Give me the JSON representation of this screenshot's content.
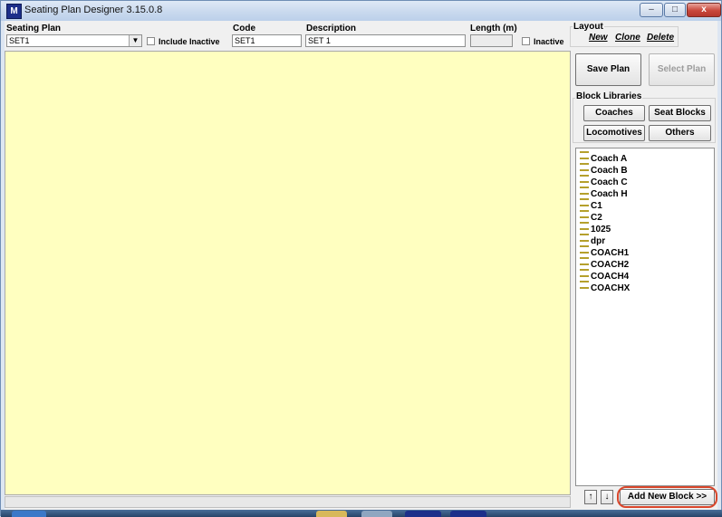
{
  "window": {
    "icon_text": "M",
    "title": "Seating Plan Designer  3.15.0.8",
    "min_glyph": "–",
    "max_glyph": "□",
    "close_glyph": "x"
  },
  "toolbar": {
    "seating_plan_label": "Seating Plan",
    "seating_plan_value": "SET1",
    "include_inactive_label": "Include Inactive",
    "code_label": "Code",
    "code_value": "SET1",
    "description_label": "Description",
    "description_value": "SET 1",
    "length_label": "Length (m)",
    "length_value": "",
    "inactive_label": "Inactive"
  },
  "layout": {
    "title": "Layout",
    "new": "New",
    "clone": "Clone",
    "delete": "Delete"
  },
  "buttons": {
    "save_plan": "Save Plan",
    "select_plan": "Select Plan",
    "add_new_block": "Add New Block >>",
    "move_up": "↑",
    "move_down": "↓"
  },
  "block_libraries": {
    "title": "Block Libraries",
    "coaches": "Coaches",
    "seat_blocks": "Seat Blocks",
    "locomotives": "Locomotives",
    "others": "Others"
  },
  "blocks": [
    "Coach A",
    "Coach B",
    "Coach C",
    "Coach H",
    "C1",
    "C2",
    "1025",
    "dpr",
    "COACH1",
    "COACH2",
    "COACH4",
    "COACHX"
  ],
  "colors": {
    "canvas": "#ffffc0",
    "highlight": "#d9462b",
    "block_icon": "#b5a02c"
  }
}
